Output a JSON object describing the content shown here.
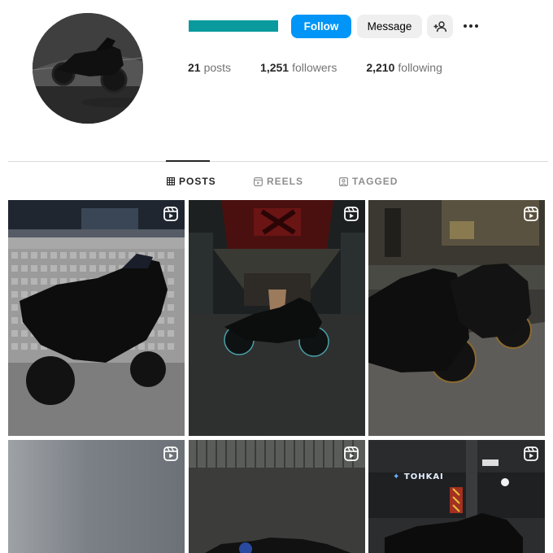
{
  "colors": {
    "accent": "#0095f6",
    "username_redaction": "#0a9a9e",
    "tab_active": "#262626",
    "tab_inactive": "#8e8e8e"
  },
  "profile": {
    "avatar_icon": "motorcycle-photo"
  },
  "actions": {
    "follow_label": "Follow",
    "message_label": "Message",
    "add_user_icon": "add-user-icon",
    "more_icon": "more-options-icon"
  },
  "stats": {
    "posts_count": "21",
    "posts_label": "posts",
    "followers_count": "1,251",
    "followers_label": "followers",
    "following_count": "2,210",
    "following_label": "following"
  },
  "tabs": [
    {
      "label": "POSTS",
      "icon": "grid-icon",
      "active": true
    },
    {
      "label": "REELS",
      "icon": "reels-icon",
      "active": false
    },
    {
      "label": "TAGGED",
      "icon": "tagged-icon",
      "active": false
    }
  ],
  "posts": {
    "tile_6_sign": "TOHKAI",
    "reel_icon": "reel-icon"
  }
}
